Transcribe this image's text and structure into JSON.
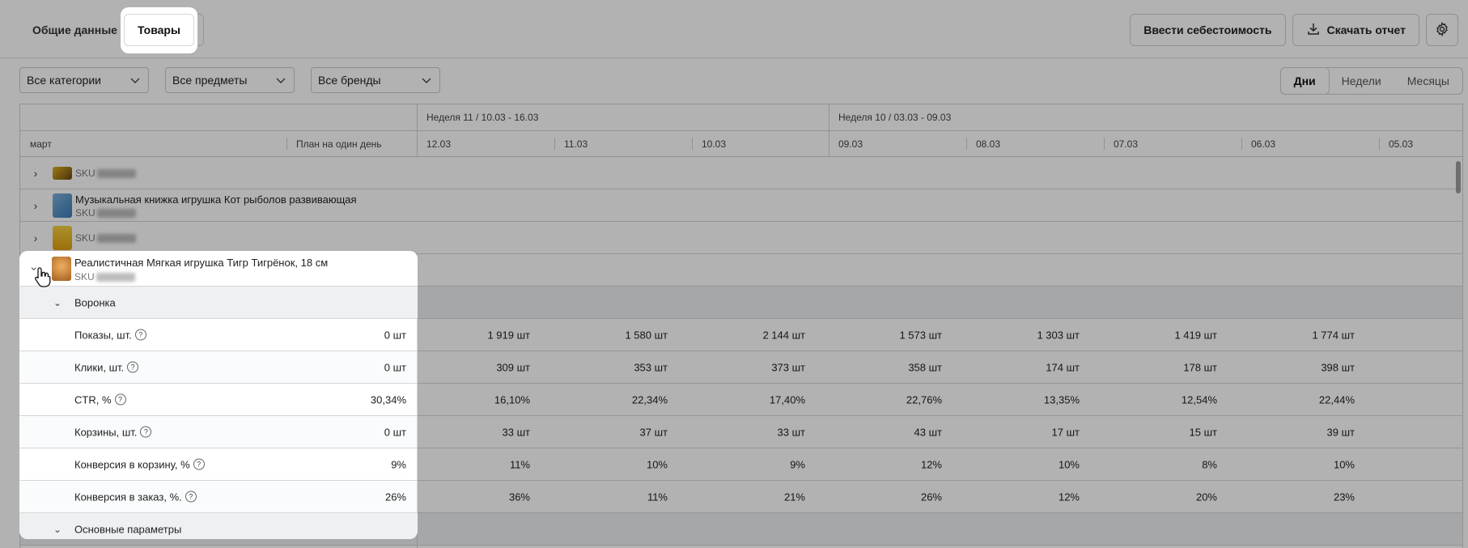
{
  "tabs": [
    {
      "label": "Общие данные",
      "active": false
    },
    {
      "label": "Товары",
      "active": true
    }
  ],
  "actions": {
    "cost_button": "Ввести себестоимость",
    "download_button": "Скачать отчет"
  },
  "filters": {
    "categories": "Все категории",
    "subjects": "Все предметы",
    "brands": "Все бренды"
  },
  "period": {
    "days": "Дни",
    "weeks": "Недели",
    "months": "Месяцы",
    "active": "Дни"
  },
  "table": {
    "month_label": "март",
    "plan_label": "План на один день",
    "weeks": [
      {
        "label": "Неделя 11 / 10.03 - 16.03"
      },
      {
        "label": "Неделя 10 / 03.03 - 09.03"
      }
    ],
    "dates": [
      "12.03",
      "11.03",
      "10.03",
      "09.03",
      "08.03",
      "07.03",
      "06.03",
      "05.03"
    ],
    "products": [
      {
        "name": "",
        "sku_prefix": "SKU",
        "expanded": false
      },
      {
        "name": "Музыкальная книжка игрушка Кот рыболов развивающая",
        "sku_prefix": "SKU",
        "expanded": false
      },
      {
        "name": "",
        "sku_prefix": "SKU",
        "expanded": false
      },
      {
        "name": "Реалистичная Мягкая игрушка Тигр Тигрёнок, 18 см",
        "sku_prefix": "SKU",
        "expanded": true
      }
    ],
    "sections": {
      "funnel": "Воронка",
      "main_params": "Основные параметры"
    },
    "metrics": [
      {
        "label": "Показы, шт.",
        "plan": "0 шт",
        "values": [
          "1 919 шт",
          "1 580 шт",
          "2 144 шт",
          "1 573 шт",
          "1 303 шт",
          "1 419 шт",
          "1 774 шт"
        ]
      },
      {
        "label": "Клики, шт.",
        "plan": "0 шт",
        "values": [
          "309 шт",
          "353 шт",
          "373 шт",
          "358 шт",
          "174 шт",
          "178 шт",
          "398 шт"
        ]
      },
      {
        "label": "CTR, %",
        "plan": "30,34%",
        "values": [
          "16,10%",
          "22,34%",
          "17,40%",
          "22,76%",
          "13,35%",
          "12,54%",
          "22,44%"
        ]
      },
      {
        "label": "Корзины, шт.",
        "plan": "0 шт",
        "values": [
          "33 шт",
          "37 шт",
          "33 шт",
          "43 шт",
          "17 шт",
          "15 шт",
          "39 шт"
        ]
      },
      {
        "label": "Конверсия в корзину, %",
        "plan": "9%",
        "values": [
          "11%",
          "10%",
          "9%",
          "12%",
          "10%",
          "8%",
          "10%"
        ]
      },
      {
        "label": "Конверсия в заказ, %.",
        "plan": "26%",
        "values": [
          "36%",
          "11%",
          "21%",
          "26%",
          "12%",
          "20%",
          "23%"
        ]
      }
    ]
  },
  "colors": {
    "overlay": "#000000",
    "section_bg": "#eef0f2"
  },
  "icons": {
    "download": "download-icon",
    "settings": "gear-icon",
    "chevron": "chevron-down-icon",
    "help": "question-circle-icon",
    "cursor": "hand-pointer-icon"
  }
}
